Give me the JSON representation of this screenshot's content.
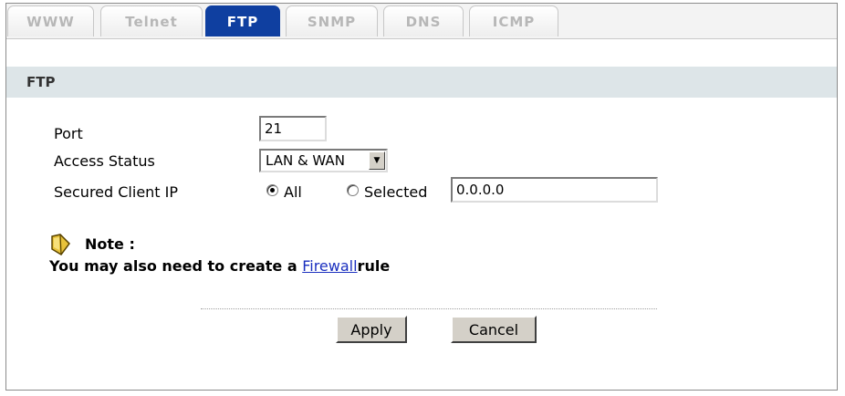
{
  "tabs": [
    {
      "label": "WWW",
      "active": false
    },
    {
      "label": "Telnet",
      "active": false
    },
    {
      "label": "FTP",
      "active": true
    },
    {
      "label": "SNMP",
      "active": false
    },
    {
      "label": "DNS",
      "active": false
    },
    {
      "label": "ICMP",
      "active": false
    }
  ],
  "section": {
    "title": "FTP"
  },
  "form": {
    "port_label": "Port",
    "port_value": "21",
    "access_status_label": "Access Status",
    "access_status_value": "LAN & WAN",
    "secured_client_ip_label": "Secured Client IP",
    "radio_all_label": "All",
    "radio_selected_label": "Selected",
    "ip_value": "0.0.0.0"
  },
  "note": {
    "title": "Note :",
    "text_prefix": "You may also need to create a ",
    "link_text": "Firewall",
    "text_suffix": "rule"
  },
  "buttons": {
    "apply": "Apply",
    "cancel": "Cancel"
  },
  "colors": {
    "active_tab": "#0f3fa0",
    "section_bg": "#dde5e8",
    "link": "#1a2fbf"
  }
}
